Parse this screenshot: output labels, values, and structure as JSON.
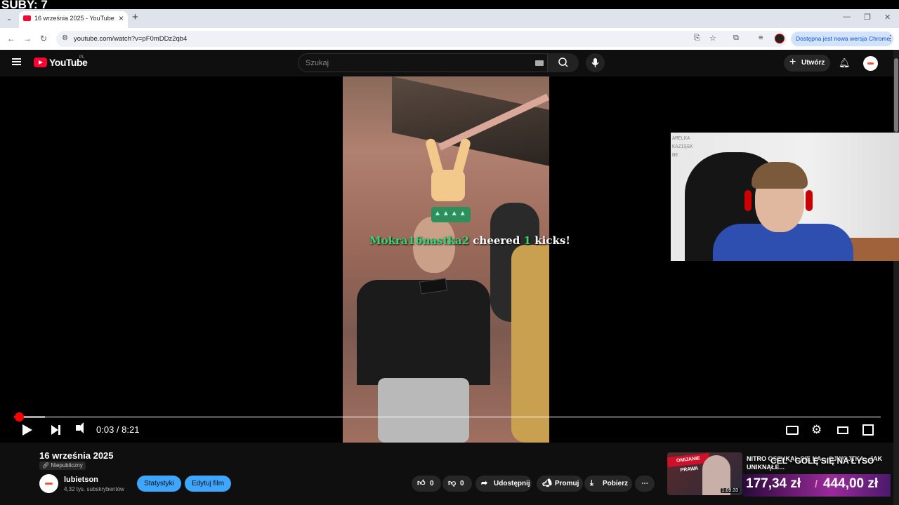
{
  "overlay": {
    "subs_counter": "SUBY: 7"
  },
  "browser": {
    "tab_title": "16 września 2025 - YouTube",
    "url": "youtube.com/watch?v=pF0mDDz2qb4",
    "update_banner": "Dostępna jest nowa wersja Chrome"
  },
  "youtube": {
    "logo_text": "YouTube",
    "logo_region": "PL",
    "search_placeholder": "Szukaj",
    "create_label": "Utwórz"
  },
  "player": {
    "cheer_user": "Mokra16nastka2",
    "cheer_mid": "cheered",
    "cheer_count": "1",
    "cheer_end": "kicks!",
    "time_current": "0:03",
    "time_total": "8:21",
    "time_display": "0:03 / 8:21",
    "progress_fraction": 0.006,
    "buffered_fraction": 0.036,
    "webcam_board_text": "AMELKA\nKAZIĘEK\nNE"
  },
  "video": {
    "title": "16 września 2025",
    "visibility": "Niepubliczny",
    "channel_name": "lubietson",
    "channel_subs": "4,32 tys. subskrybentów",
    "stats_button": "Statystyki",
    "edit_button": "Edytuj film",
    "likes": "0",
    "dislikes": "0",
    "share_label": "Udostępnij",
    "promote_label": "Promuj",
    "download_label": "Pobierz"
  },
  "recommended": {
    "thumb_banner": "OMIJANIE PRAWA",
    "duration": "1:09:33",
    "title": "NITRO OSZUKAŁ SIĘ NA... OJWOJTKA - JAK UNIKNĄŁE..."
  },
  "stream_overlay": {
    "goal_text": "CEL - GOLĘ SIĘ NA ŁYSO",
    "amount_current": "177,34 zł",
    "amount_separator": "/",
    "amount_goal": "444,00 zł"
  },
  "colors": {
    "accent_red": "#ff0033",
    "cheer_green": "#38d67a",
    "button_blue": "#3ea6ff"
  }
}
